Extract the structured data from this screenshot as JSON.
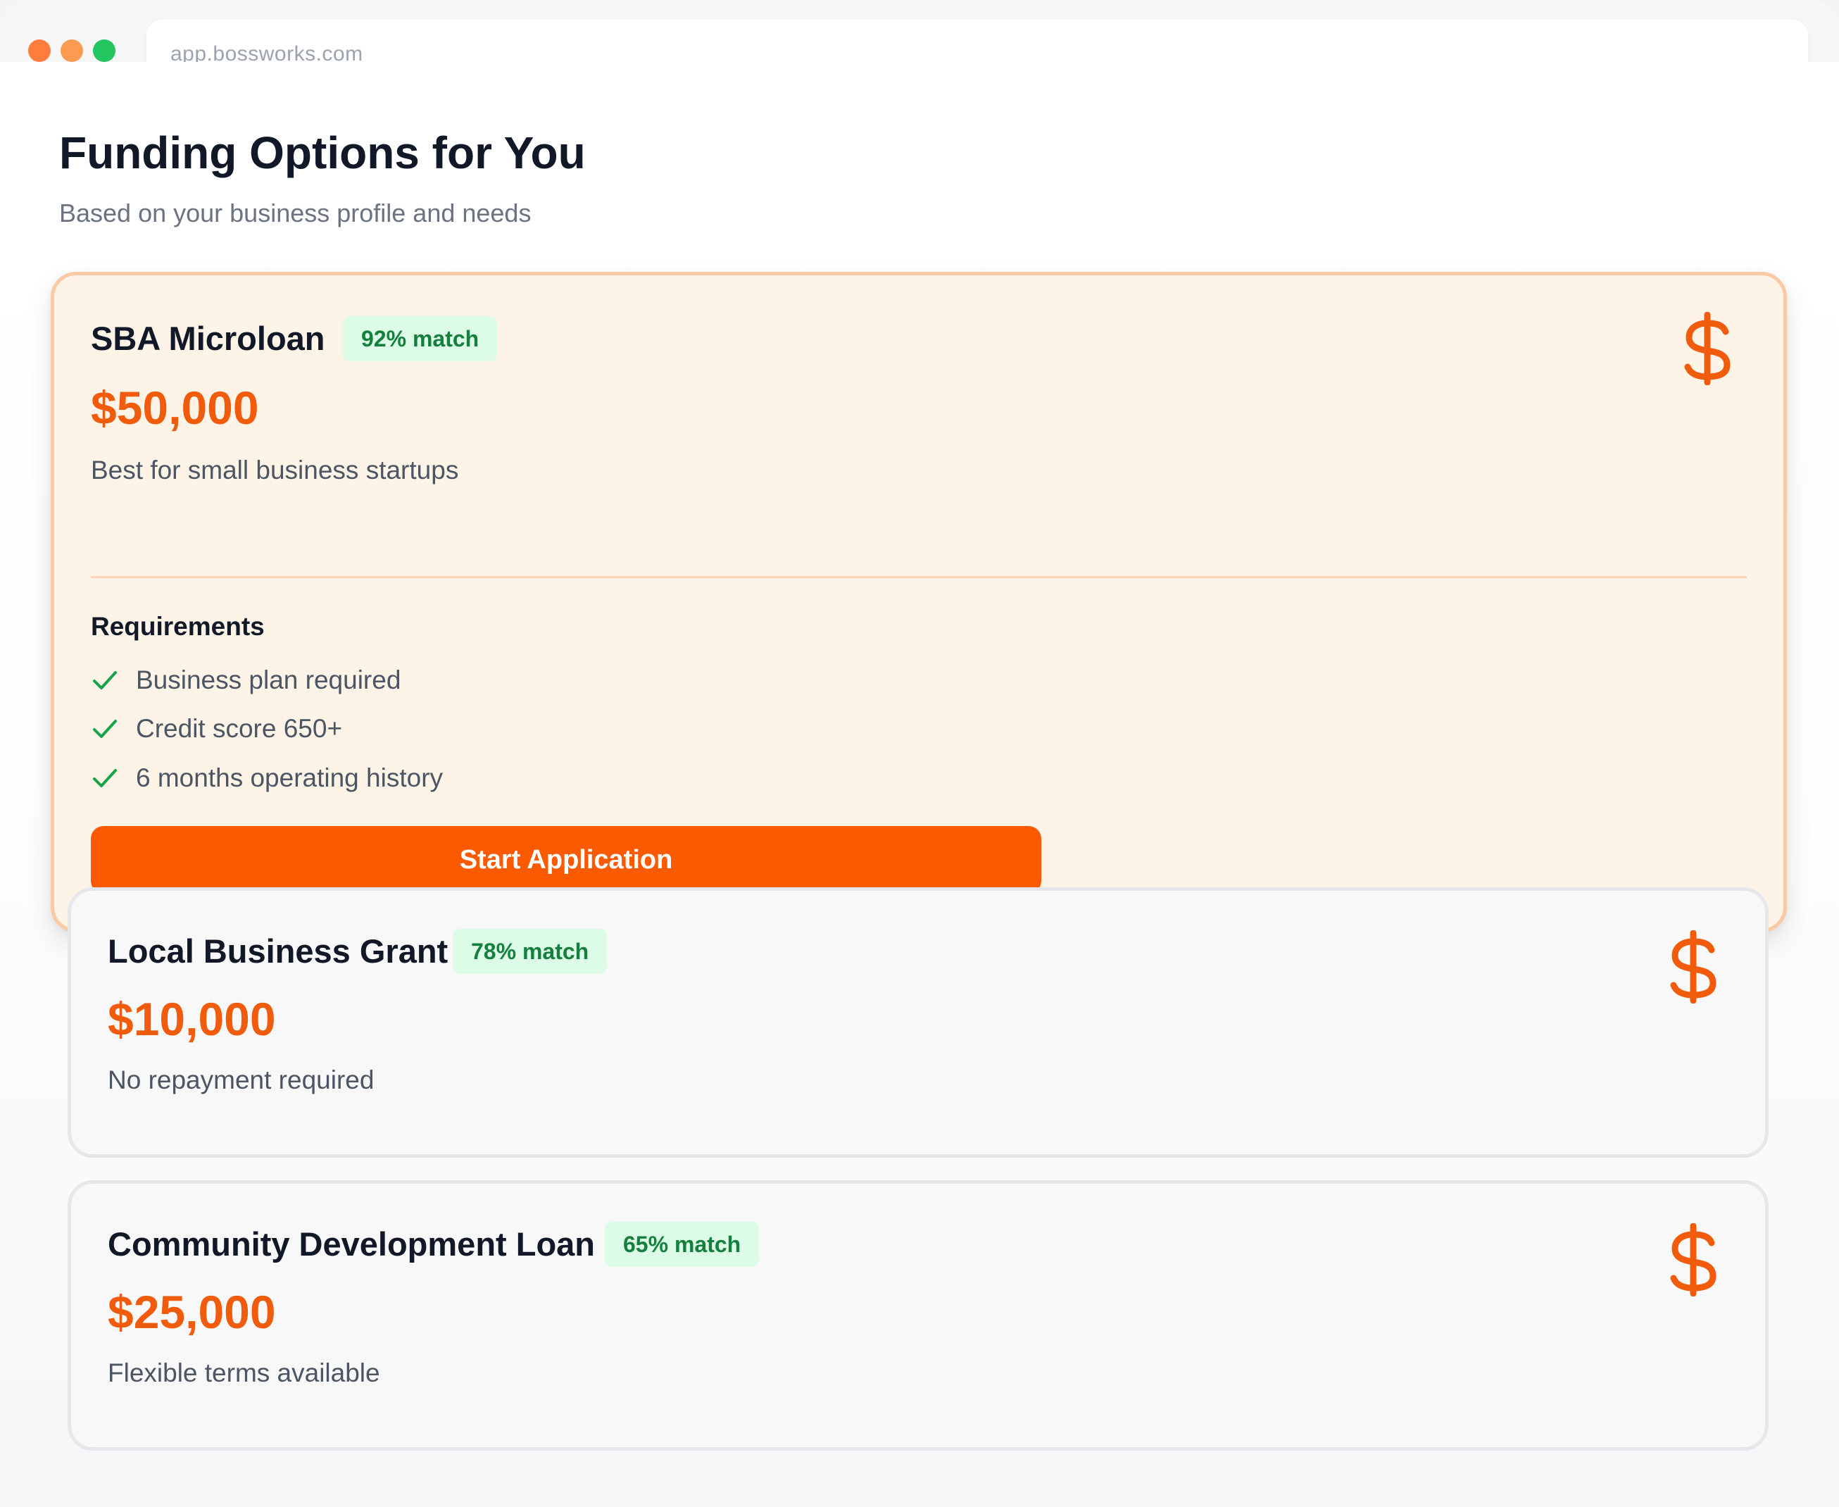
{
  "browser": {
    "url": "app.bossworks.com",
    "traffic_lights": [
      "#fd7d3d",
      "#fd9b53",
      "#22c55e"
    ]
  },
  "page": {
    "title": "Funding Options for You",
    "subtitle": "Based on your business profile and needs"
  },
  "colors": {
    "accent": "#fb5a00",
    "amount": "#f15c0c",
    "match_badge_bg": "#dcfce7",
    "match_badge_text": "#15803d",
    "check": "#16a34a"
  },
  "options": [
    {
      "name": "SBA Microloan",
      "match": "92% match",
      "amount": "$50,000",
      "description": "Best for small business startups",
      "icon": "dollar-icon",
      "expanded": true,
      "requirements_heading": "Requirements",
      "requirements": [
        "Business plan required",
        "Credit score 650+",
        "6 months operating history"
      ],
      "cta_label": "Start Application"
    },
    {
      "name": "Local Business Grant",
      "match": "78% match",
      "amount": "$10,000",
      "description": "No repayment required",
      "icon": "dollar-icon",
      "expanded": false
    },
    {
      "name": "Community Development Loan",
      "match": "65% match",
      "amount": "$25,000",
      "description": "Flexible terms available",
      "icon": "dollar-icon",
      "expanded": false
    }
  ]
}
